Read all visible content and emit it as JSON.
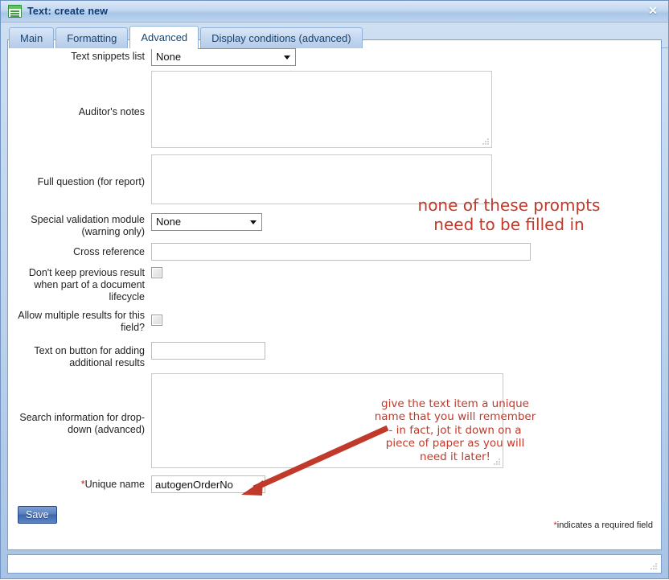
{
  "window": {
    "title": "Text: create new",
    "icon": "document-list-icon",
    "close_label": "✕"
  },
  "tabs": [
    {
      "label": "Main",
      "active": false
    },
    {
      "label": "Formatting",
      "active": false
    },
    {
      "label": "Advanced",
      "active": true
    },
    {
      "label": "Display conditions (advanced)",
      "active": false
    }
  ],
  "form": {
    "text_snippets_list": {
      "label": "Text snippets list",
      "value": "None"
    },
    "auditors_notes": {
      "label": "Auditor's notes",
      "value": ""
    },
    "full_question": {
      "label": "Full question (for report)",
      "value": ""
    },
    "special_validation": {
      "label": "Special validation module (warning only)",
      "value": "None"
    },
    "cross_reference": {
      "label": "Cross reference",
      "value": ""
    },
    "dont_keep_previous": {
      "label": "Don't keep previous result when part of a document lifecycle",
      "checked": false
    },
    "allow_multiple": {
      "label": "Allow multiple results for this field?",
      "checked": false
    },
    "button_text": {
      "label": "Text on button for adding additional results",
      "value": ""
    },
    "search_information": {
      "label": "Search information for drop-down (advanced)",
      "value": ""
    },
    "unique_name": {
      "label": "Unique name",
      "required_marker": "*",
      "value": "autogenOrderNo"
    }
  },
  "footer": {
    "save_label": "Save",
    "required_note_star": "*",
    "required_note": "indicates a required field"
  },
  "annotations": {
    "top": "none of these prompts\nneed to be filled in",
    "bottom": "give the text item a unique\nname that you will remember\n- in fact, jot it down on a\npiece of paper as you will\nneed it later!",
    "arrow_color": "#c0392b"
  },
  "colors": {
    "annotation_red": "#c0392b",
    "required_red": "#cc2222",
    "title_blue": "#0d3a72",
    "accent_blue": "#3f66ac"
  }
}
